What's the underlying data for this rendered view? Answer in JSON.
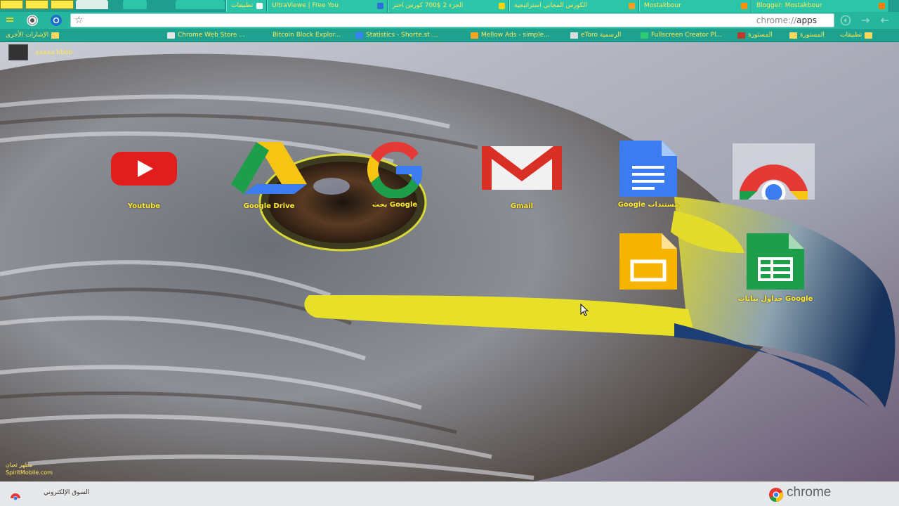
{
  "window": {
    "buttons": [
      "",
      "",
      ""
    ]
  },
  "tabs": [
    {
      "label": "تطبيقات",
      "fav_color": "#ffffff"
    },
    {
      "label": "UltraViewe | Free You",
      "fav_color": "#2a6fd6"
    },
    {
      "label": "الجزء 2 $700 كورس احتر",
      "fav_color": "#ffd400"
    },
    {
      "label": "الكورس المجاني استراتيجية",
      "fav_color": "#f0a020"
    },
    {
      "label": "Mostakbour",
      "fav_color": "#ff8f00"
    },
    {
      "label": "Blogger: Mostakbour",
      "fav_color": "#ff7a00"
    }
  ],
  "omnibox": {
    "url_dim": "chrome://",
    "url_main": "apps"
  },
  "bookmarks": [
    {
      "label": "الإشارات الأخرى",
      "color": "#ffd75e",
      "rtl": true
    },
    {
      "label": "Chrome Web Store ...",
      "color": "#e6e6e6",
      "rtl": false
    },
    {
      "label": "Bitcoin Block Explor...",
      "color": "#3b82f6",
      "rtl": false
    },
    {
      "label": "Statistics - Shorte.st ...",
      "color": "#f5a623",
      "rtl": false
    },
    {
      "label": "Mellow Ads - simple...",
      "color": "#7e7e7e",
      "rtl": false
    },
    {
      "label": "eToro الرسمية",
      "color": "#2ecc71",
      "rtl": false
    },
    {
      "label": "Fullscreen Creator Pl...",
      "color": "#111111",
      "rtl": false
    },
    {
      "label": "المستورة",
      "color": "#c0392b",
      "rtl": false
    },
    {
      "label": "المستورة",
      "color": "#ffd75e",
      "rtl": false
    },
    {
      "label": "تطبيقات",
      "color": "#ffd75e",
      "rtl": true
    }
  ],
  "user": {
    "name": "aaaaa bbbb"
  },
  "apps": [
    {
      "label": "Youtube",
      "icon": "youtube-icon"
    },
    {
      "label": "Google Drive",
      "icon": "google-drive-icon"
    },
    {
      "label": "بحث Google",
      "icon": "google-search-icon"
    },
    {
      "label": "Gmail",
      "icon": "gmail-icon"
    },
    {
      "label": "Google مستندات",
      "icon": "google-docs-icon"
    },
    {
      "label": "",
      "icon": "chrome-icon"
    },
    {
      "label": "",
      "icon": "google-slides-icon"
    },
    {
      "label": "جداول بيانات Google",
      "icon": "google-sheets-icon"
    }
  ],
  "credit": {
    "line1": "مظهر ثعبان",
    "line2": "SpiritMobile.com"
  },
  "bottombar": {
    "store_label": "السوق الإلكتروني",
    "brand": "chrome"
  },
  "colors": {
    "theme": "#26b59d",
    "label_yellow": "#ffe82e"
  }
}
